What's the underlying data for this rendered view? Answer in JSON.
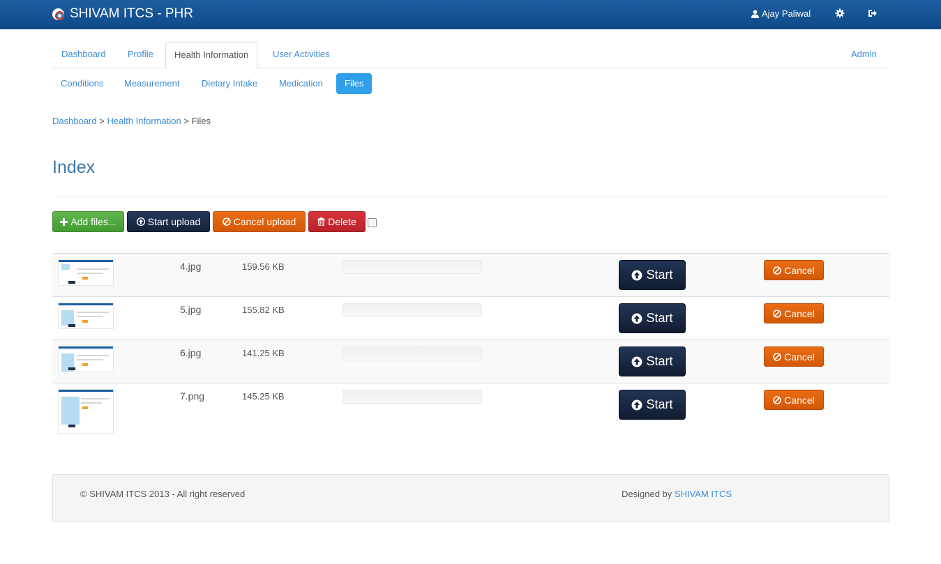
{
  "app": {
    "title": "SHIVAM ITCS - PHR"
  },
  "navbar": {
    "user_name": "Ajay Paliwal",
    "settings_icon": "gear-icon",
    "logout_icon": "sign-out-icon"
  },
  "main_tabs": [
    {
      "label": "Dashboard",
      "active": false
    },
    {
      "label": "Profile",
      "active": false
    },
    {
      "label": "Health Information",
      "active": true
    },
    {
      "label": "User Activities",
      "active": false
    }
  ],
  "admin_tab": {
    "label": "Admin"
  },
  "sub_tabs": [
    {
      "label": "Conditions",
      "active": false
    },
    {
      "label": "Measurement",
      "active": false
    },
    {
      "label": "Dietary Intake",
      "active": false
    },
    {
      "label": "Medication",
      "active": false
    },
    {
      "label": "Files",
      "active": true
    }
  ],
  "breadcrumb": {
    "item1": "Dashboard",
    "item2": "Health Information",
    "current": "Files",
    "separator": ">"
  },
  "page": {
    "title": "Index"
  },
  "toolbar": {
    "add_label": "Add files...",
    "start_label": "Start upload",
    "cancel_label": "Cancel upload",
    "delete_label": "Delete"
  },
  "files": [
    {
      "name": "4.jpg",
      "size": "159.56 KB",
      "start_label": "Start",
      "cancel_label": "Cancel"
    },
    {
      "name": "5.jpg",
      "size": "155.82 KB",
      "start_label": "Start",
      "cancel_label": "Cancel"
    },
    {
      "name": "6.jpg",
      "size": "141.25 KB",
      "start_label": "Start",
      "cancel_label": "Cancel"
    },
    {
      "name": "7.png",
      "size": "145.25 KB",
      "start_label": "Start",
      "cancel_label": "Cancel"
    }
  ],
  "footer": {
    "copyright": "© SHIVAM ITCS 2013 - All right reserved",
    "designed_prefix": "Designed by",
    "designed_link": "SHIVAM ITCS"
  },
  "colors": {
    "navbar": "#0f4a8a",
    "link": "#3b8bd6",
    "active_pill": "#2e9fe8",
    "green": "#4aa63a",
    "navy": "#1b2a45",
    "orange": "#e06010",
    "red": "#c92a31"
  }
}
